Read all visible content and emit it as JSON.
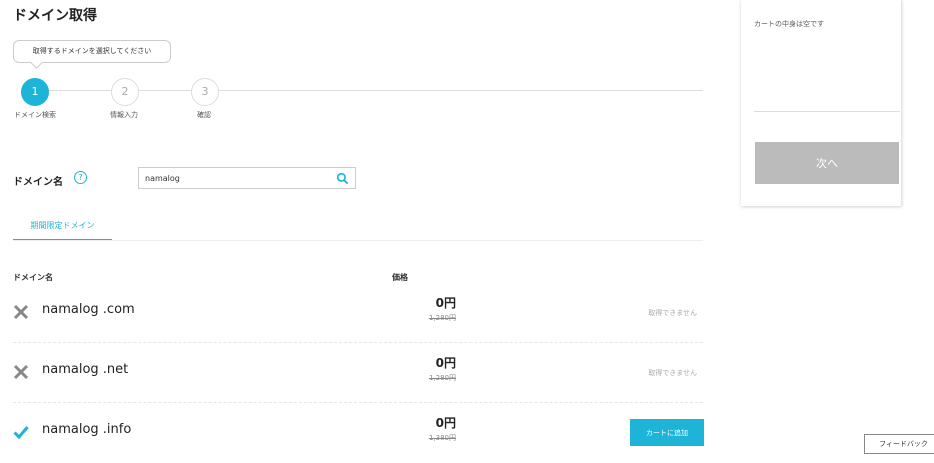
{
  "page": {
    "title": "ドメイン取得",
    "tooltip": "取得するドメインを選択してください"
  },
  "steps": [
    {
      "number": "1",
      "label": "ドメイン検索",
      "active": true
    },
    {
      "number": "2",
      "label": "情報入力",
      "active": false
    },
    {
      "number": "3",
      "label": "確認",
      "active": false
    }
  ],
  "search": {
    "label": "ドメイン名",
    "help": "?",
    "value": "namalog"
  },
  "tab": {
    "label": "期間限定ドメイン"
  },
  "table": {
    "headers": {
      "name": "ドメイン名",
      "price": "価格"
    },
    "rows": [
      {
        "name": "namalog",
        "tld": ".com",
        "available": false,
        "price": "0円",
        "old_price": "1,280円",
        "status": "取得できません"
      },
      {
        "name": "namalog",
        "tld": ".net",
        "available": false,
        "price": "0円",
        "old_price": "1,280円",
        "status": "取得できません"
      },
      {
        "name": "namalog",
        "tld": ".info",
        "available": true,
        "price": "0円",
        "old_price": "1,380円",
        "action": "カートに追加"
      }
    ]
  },
  "cart": {
    "empty_text": "カートの中身は空です",
    "next_label": "次へ"
  },
  "feedback": {
    "label": "フィードバック"
  },
  "colors": {
    "accent": "#1eb4d8",
    "unavailable": "#888888",
    "disabled_button": "#bbbbbb"
  }
}
